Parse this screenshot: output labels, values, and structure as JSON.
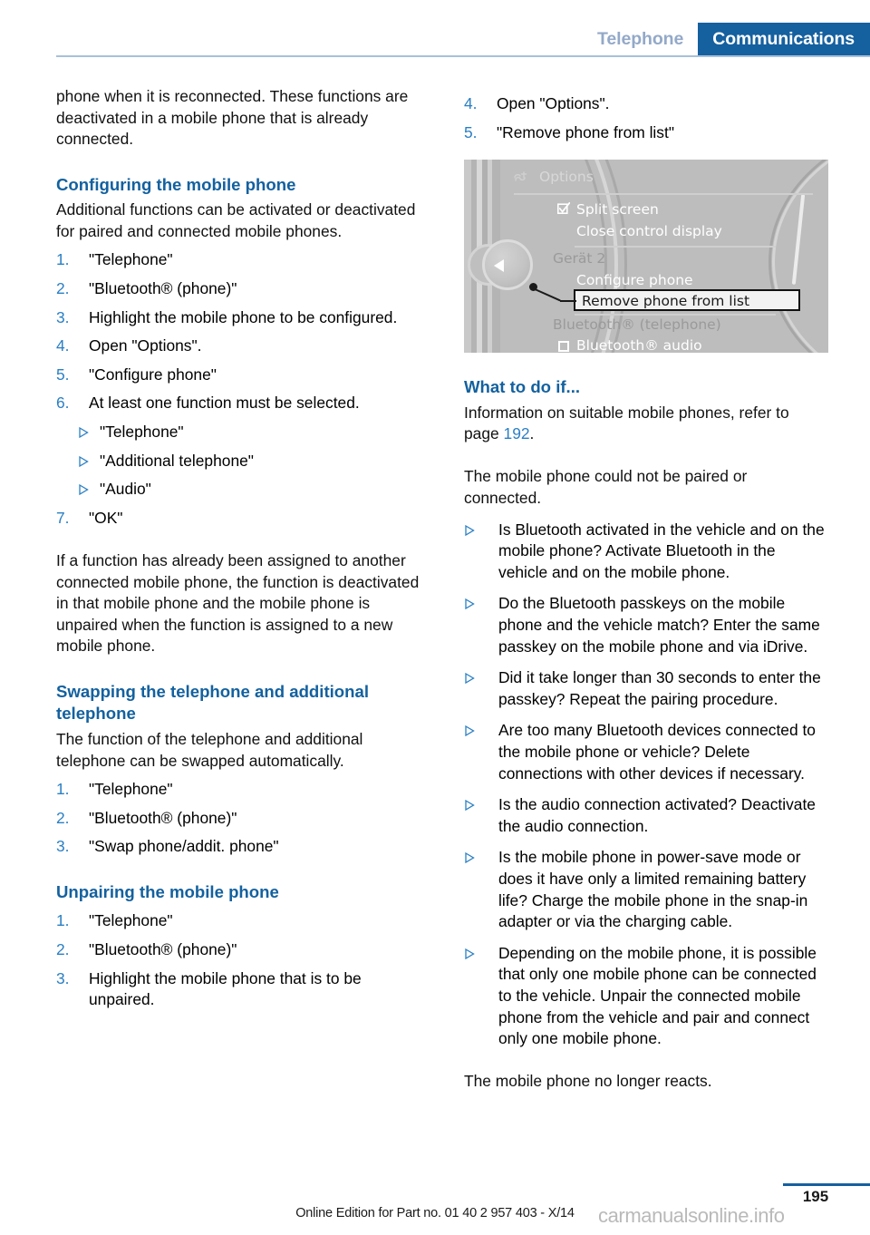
{
  "header": {
    "inactive_tab": "Telephone",
    "active_tab": "Communications",
    "accent_color": "#15609f",
    "inactive_color": "#93a9c8"
  },
  "left_column": {
    "continued_paragraph": "phone when it is reconnected. These functions are deactivated in a mobile phone that is already connected.",
    "sections": [
      {
        "heading": "Configuring the mobile phone",
        "intro": "Additional functions can be activated or deactivated for paired and connected mobile phones.",
        "steps": [
          {
            "num": "1.",
            "text": "\"Telephone\""
          },
          {
            "num": "2.",
            "text": "\"Bluetooth® (phone)\""
          },
          {
            "num": "3.",
            "text": "Highlight the mobile phone to be configured."
          },
          {
            "num": "4.",
            "text": "Open \"Options\"."
          },
          {
            "num": "5.",
            "text": "\"Configure phone\""
          },
          {
            "num": "6.",
            "text": "At least one function must be selected."
          }
        ],
        "sub_bullets": [
          "\"Telephone\"",
          "\"Additional telephone\"",
          "\"Audio\""
        ],
        "final_step": {
          "num": "7.",
          "text": "\"OK\""
        },
        "outro": "If a function has already been assigned to another connected mobile phone, the function is deactivated in that mobile phone and the mobile phone is unpaired when the function is assigned to a new mobile phone."
      },
      {
        "heading": "Swapping the telephone and additional telephone",
        "intro": "The function of the telephone and additional telephone can be swapped automatically.",
        "steps": [
          {
            "num": "1.",
            "text": "\"Telephone\""
          },
          {
            "num": "2.",
            "text": "\"Bluetooth® (phone)\""
          },
          {
            "num": "3.",
            "text": "\"Swap phone/addit. phone\""
          }
        ]
      },
      {
        "heading": "Unpairing the mobile phone",
        "steps": [
          {
            "num": "1.",
            "text": "\"Telephone\""
          },
          {
            "num": "2.",
            "text": "\"Bluetooth® (phone)\""
          },
          {
            "num": "3.",
            "text": "Highlight the mobile phone that is to be unpaired."
          }
        ]
      }
    ]
  },
  "right_column": {
    "continued_steps": [
      {
        "num": "4.",
        "text": "Open \"Options\"."
      },
      {
        "num": "5.",
        "text": "\"Remove phone from list\""
      }
    ],
    "idrive_screenshot": {
      "title": "Options",
      "title_icon": "options-gear-icon",
      "items": [
        {
          "label": "Split screen",
          "checkbox": "checked",
          "state": "enabled"
        },
        {
          "label": "Close control display",
          "checkbox": "none",
          "state": "enabled"
        },
        {
          "label": "Gerät 2",
          "checkbox": "none",
          "state": "dimmed"
        },
        {
          "label": "Configure phone",
          "checkbox": "none",
          "state": "enabled"
        },
        {
          "label": "Remove phone from list",
          "checkbox": "none",
          "state": "highlighted"
        },
        {
          "label": "Bluetooth® (telephone)",
          "checkbox": "none",
          "state": "dimmed"
        },
        {
          "label": "Bluetooth® audio",
          "checkbox": "unchecked",
          "state": "enabled"
        }
      ]
    },
    "what_to_do_if": {
      "heading": "What to do if...",
      "intro_before_xref": "Information on suitable mobile phones, refer to page ",
      "intro_xref": "192",
      "intro_after_xref": ".",
      "problem_1": "The mobile phone could not be paired or connected.",
      "bullets_1": [
        "Is Bluetooth activated in the vehicle and on the mobile phone? Activate Bluetooth in the vehicle and on the mobile phone.",
        "Do the Bluetooth passkeys on the mobile phone and the vehicle match? Enter the same passkey on the mobile phone and via iDrive.",
        "Did it take longer than 30 seconds to enter the passkey? Repeat the pairing procedure.",
        "Are too many Bluetooth devices connected to the mobile phone or vehicle? Delete connections with other devices if necessary.",
        "Is the audio connection activated? Deactivate the audio connection.",
        "Is the mobile phone in power-save mode or does it have only a limited remaining battery life? Charge the mobile phone in the snap-in adapter or via the charging cable.",
        "Depending on the mobile phone, it is possible that only one mobile phone can be connected to the vehicle. Unpair the connected mobile phone from the vehicle and pair and connect only one mobile phone."
      ],
      "problem_2": "The mobile phone no longer reacts."
    }
  },
  "footer": {
    "page_number": "195",
    "edition_note": "Online Edition for Part no. 01 40 2 957 403 - X/14",
    "watermark": "carmanualsonline.info"
  }
}
